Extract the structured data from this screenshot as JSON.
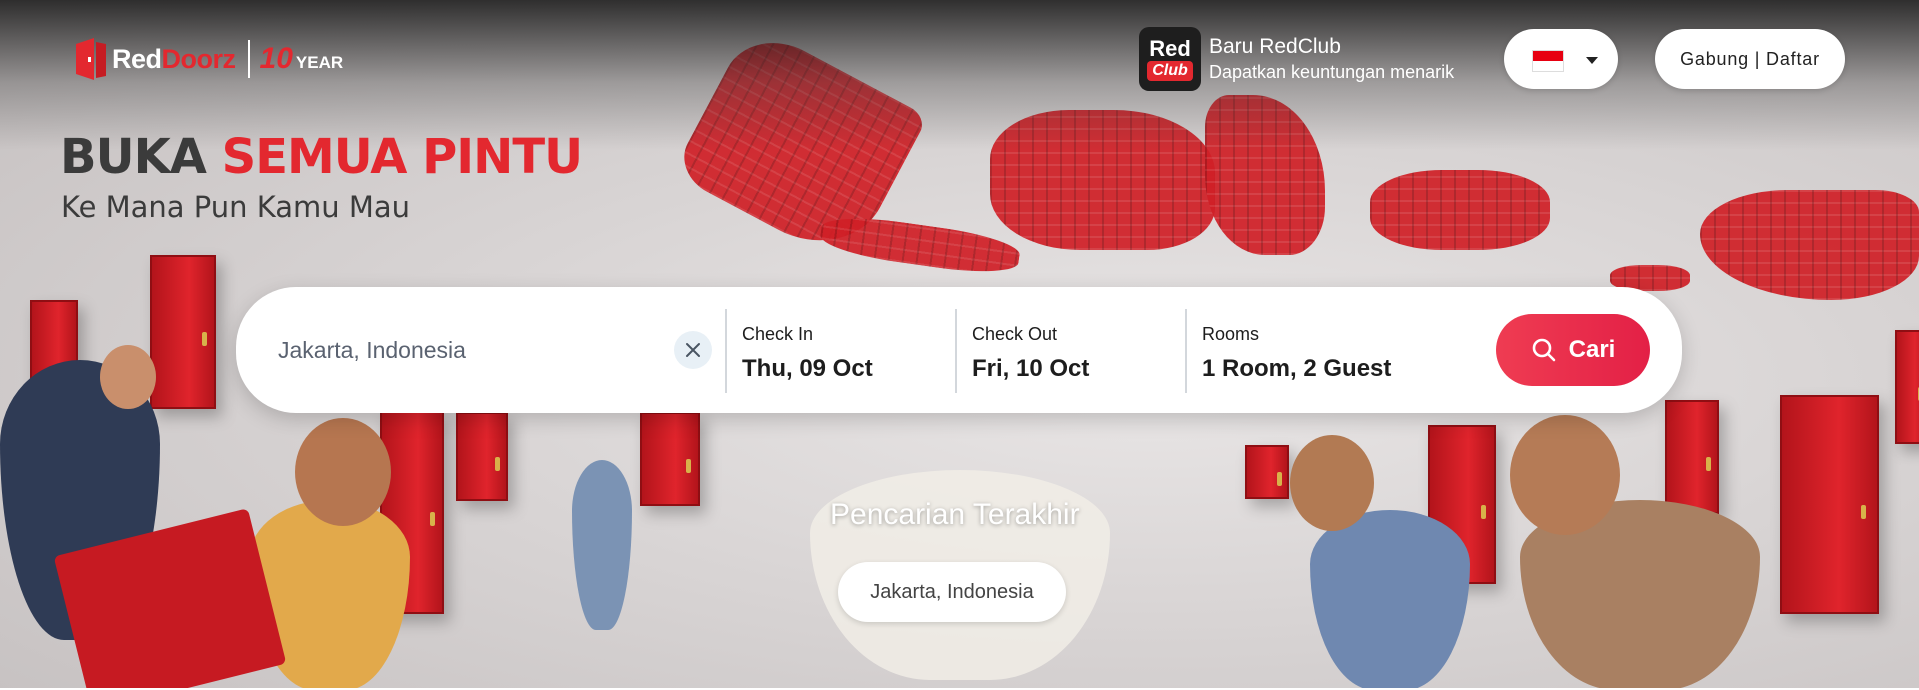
{
  "header": {
    "logo": {
      "brand_red": "Red",
      "brand_doorz": "Doorz",
      "anniversary_number": "10",
      "anniversary_word": "YEAR"
    },
    "redclub": {
      "badge_top": "Red",
      "badge_bottom": "Club",
      "title": "Baru RedClub",
      "subtitle": "Dapatkan keuntungan menarik"
    },
    "language": {
      "flag": "indonesia-flag-icon"
    },
    "join_button": "Gabung | Daftar"
  },
  "hero": {
    "headline_part1": "BUKA",
    "headline_part2": "SEMUA PINTU",
    "subheadline": "Ke Mana Pun Kamu Mau"
  },
  "search": {
    "location_value": "Jakarta, Indonesia",
    "check_in_label": "Check In",
    "check_in_value": "Thu, 09 Oct",
    "check_out_label": "Check Out",
    "check_out_value": "Fri, 10 Oct",
    "rooms_label": "Rooms",
    "rooms_value": "1 Room, 2 Guest",
    "submit_label": "Cari"
  },
  "recent": {
    "title": "Pencarian Terakhir",
    "items": [
      "Jakarta, Indonesia"
    ]
  },
  "colors": {
    "brand_red": "#e3282f",
    "search_button": "#e32046",
    "text_dark": "#3b3b3b"
  }
}
